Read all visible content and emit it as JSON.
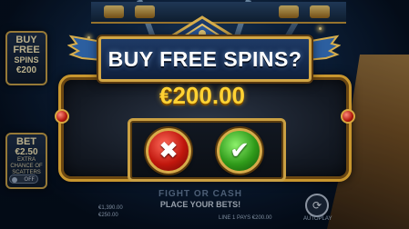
{
  "modal": {
    "title": "BUY FREE SPINS?",
    "price": "€200.00",
    "cancel_icon": "✖",
    "confirm_icon": "✔"
  },
  "side_panel": {
    "buy_line1": "BUY",
    "buy_line2": "FREE",
    "buy_line3": "SPINS",
    "buy_price": "€200",
    "bet_label": "BET",
    "bet_value": "€2.50",
    "bet_desc1": "EXTRA",
    "bet_desc2": "CHANCE OF",
    "bet_desc3": "SCATTERS",
    "toggle_state": "OFF"
  },
  "hud": {
    "logo": "FIGHT OR CASH",
    "status": "PLACE YOUR BETS!",
    "credit": "€1,390.00",
    "bet": "€250.00",
    "ways": "LINE 1 PAYS €200.00",
    "autoplay": "AUTOPLAY"
  },
  "colors": {
    "gold": "#d2a645",
    "price": "#ffd233",
    "cancel": "#c0170d",
    "confirm": "#2f9a1a"
  }
}
